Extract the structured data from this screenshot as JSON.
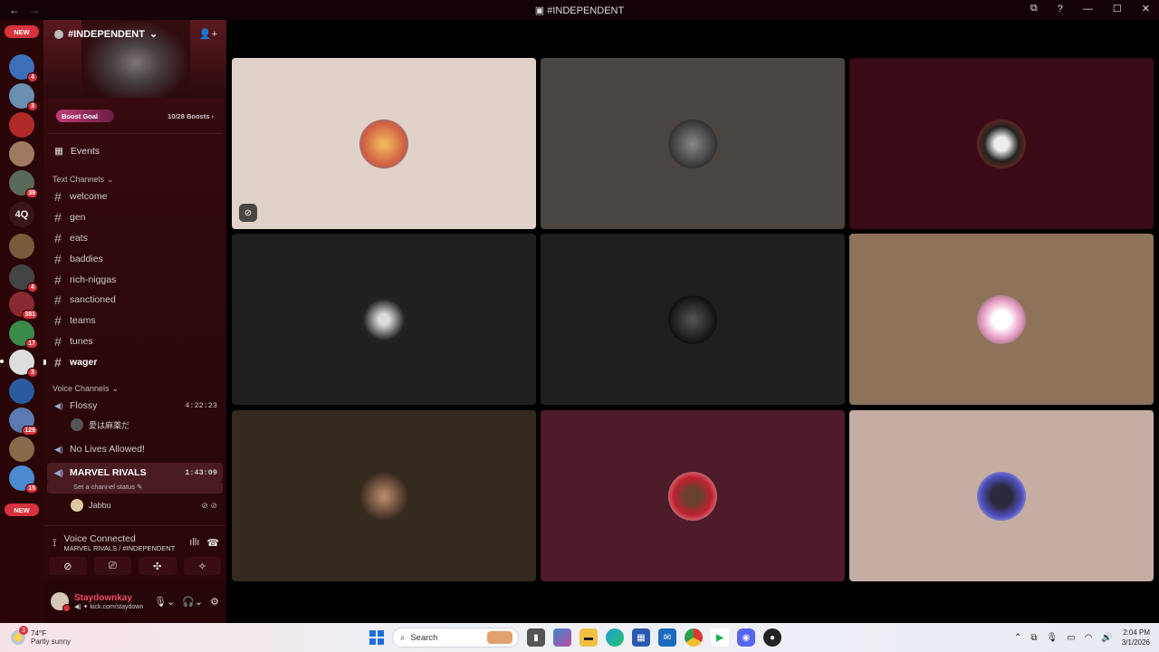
{
  "titlebar": {
    "title": "#INDEPENDENT",
    "back_icon": "arrow-left-icon",
    "forward_icon": "arrow-right-icon"
  },
  "rail": {
    "new_top": "NEW",
    "new_bottom": "NEW",
    "badges": [
      "4",
      "3",
      "39",
      "4",
      "381",
      "17",
      "3",
      "126",
      "15"
    ],
    "text_guild": "4Q"
  },
  "server": {
    "name": "#INDEPENDENT",
    "boost_goal": "Boost Goal",
    "boost_count": "10/28 Boosts",
    "events": "Events"
  },
  "text_channels": {
    "category": "Text Channels",
    "items": [
      {
        "label": "welcome"
      },
      {
        "label": "gen"
      },
      {
        "label": "eats"
      },
      {
        "label": "baddies"
      },
      {
        "label": "rich-niggas"
      },
      {
        "label": "sanctioned"
      },
      {
        "label": "teams"
      },
      {
        "label": "tunes"
      },
      {
        "label": "wager"
      }
    ]
  },
  "voice_channels": {
    "category": "Voice Channels",
    "flossy": {
      "label": "Flossy",
      "time": "4:22:23",
      "user": "愛は麻薬だ"
    },
    "no_lives": {
      "label": "No Lives Allowed!"
    },
    "marvel": {
      "label": "MARVEL RIVALS",
      "time": "1:43:09",
      "status": "Set a channel status",
      "user": "Jabbu"
    }
  },
  "voice_connected": {
    "title": "Voice Connected",
    "subtitle": "MARVEL RIVALS / #INDEPENDENT"
  },
  "user": {
    "name": "Staydownkay",
    "status": "kick.com/staydown"
  },
  "tiles": [
    {
      "bg": "#e0d2c8"
    },
    {
      "bg": "#4a4540"
    },
    {
      "bg": "#3a0c17"
    },
    {
      "bg": "#1f1f1f"
    },
    {
      "bg": "#1f1f1f"
    },
    {
      "bg": "#8c735a"
    },
    {
      "bg": "#352a20"
    },
    {
      "bg": "#4e1b2a"
    },
    {
      "bg": "#c5ada4"
    }
  ],
  "taskbar": {
    "weather_badge": "3",
    "temp": "74°F",
    "weather": "Partly sunny",
    "search": "Search",
    "time": "2:04 PM",
    "date": "3/1/2026"
  },
  "colors": {
    "accent": "#d8323c",
    "sidebar": "#2d070b"
  }
}
